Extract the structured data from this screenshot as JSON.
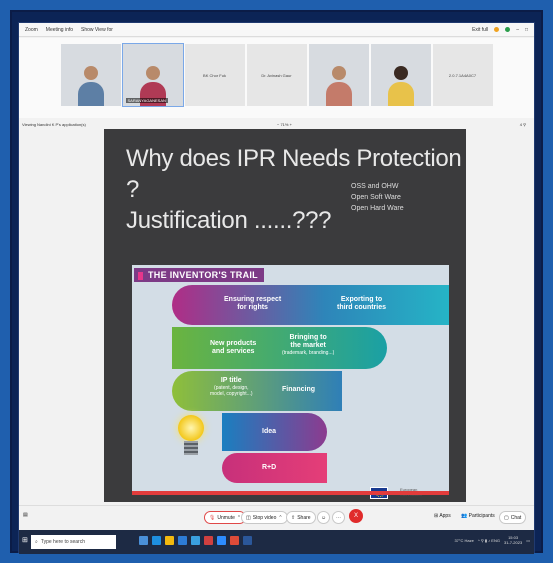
{
  "titlebar": {
    "items": [
      "Zoom",
      "Meeting info",
      "Show View for"
    ],
    "right": "Exit full"
  },
  "participants": [
    {
      "name": "",
      "type": "video"
    },
    {
      "name": "SARANYAGANESAN",
      "type": "video",
      "active": true
    },
    {
      "name": "BK Chor Fuk",
      "type": "name"
    },
    {
      "name": "Dr. Avinash Gaur",
      "type": "name"
    },
    {
      "name": "",
      "type": "video"
    },
    {
      "name": "",
      "type": "video"
    },
    {
      "name": "2.0.7.1A4A0C7",
      "type": "name"
    }
  ],
  "viewbar": {
    "label": "Viewing Nandini K P's application(s)",
    "zoom": "− 71% +",
    "page": "4 ⚲"
  },
  "slide": {
    "title_line1": "Why does IPR Needs Protection ?",
    "title_line2": "Justification ......???",
    "notes": [
      "OSS and OHW",
      "Open Soft Ware",
      "Open Hard Ware"
    ],
    "inventor": {
      "title": "THE INVENTOR'S TRAIL",
      "b1a": "Ensuring respect",
      "b1b": "for rights",
      "b1c": "Exporting to",
      "b1d": "third countries",
      "b2a": "New products",
      "b2b": "and services",
      "b2c": "Bringing to",
      "b2d": "the market",
      "b2e": "(trademark, branding...)",
      "b3a": "IP title",
      "b3b": "(patent, design,",
      "b3c": "model, copyright...)",
      "b3d": "Financing",
      "b4": "Idea",
      "b5": "R+D",
      "ec_line1": "European",
      "ec_line2": "Commission"
    }
  },
  "toolbar": {
    "unmute": "Unmute",
    "stop_video": "Stop video",
    "share": "Share",
    "apps": "Apps",
    "participants": "Participants",
    "chat": "Chat",
    "end": "X"
  },
  "taskbar": {
    "search_placeholder": "Type here to search",
    "weather": "37°C Haze",
    "time": "15:03",
    "date": "31-7-2023"
  },
  "colors": {
    "accent": "#e02b2b",
    "slide_bg": "#3b3b3d"
  }
}
